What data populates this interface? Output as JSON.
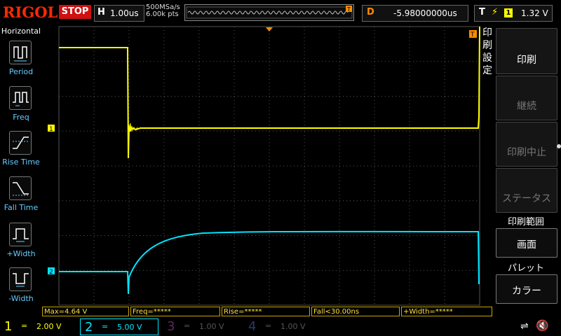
{
  "header": {
    "brand": "RIGOL",
    "run_state": "STOP",
    "timebase_key": "H",
    "timebase_value": "1.00us",
    "sample_rate": "500MSa/s",
    "memory_depth": "6.00k pts",
    "delay_key": "D",
    "delay_value": "-5.98000000us",
    "trigger_key": "T",
    "trigger_edge_icon": "rising-edge-icon",
    "trigger_channel": "1",
    "trigger_level": "1.32 V"
  },
  "left_menu": {
    "title": "Horizontal",
    "items": [
      {
        "label": "Period",
        "icon": "period-icon"
      },
      {
        "label": "Freq",
        "icon": "freq-icon"
      },
      {
        "label": "Rise Time",
        "icon": "rise-time-icon"
      },
      {
        "label": "Fall Time",
        "icon": "fall-time-icon"
      },
      {
        "label": "+Width",
        "icon": "positive-width-icon"
      },
      {
        "label": "-Width",
        "icon": "negative-width-icon"
      }
    ]
  },
  "right_menu": {
    "vertical_title": [
      "印",
      "刷",
      "設",
      "定"
    ],
    "print_button": "印刷",
    "continue_button": "継続",
    "stop_print_button": "印刷中止",
    "status_button": "ステータス",
    "range_header": "印刷範囲",
    "range_value": "画面",
    "palette_header": "パレット",
    "palette_value": "カラー"
  },
  "measurements": [
    "Max=4.64 V",
    "Freq=*****",
    "Rise=*****",
    "Fall<30.00ns",
    "+Width=*****"
  ],
  "channels": [
    {
      "number": "1",
      "coupling": "=",
      "scale": "2.00 V",
      "color": "#ffff00",
      "active": true
    },
    {
      "number": "2",
      "coupling": "=",
      "scale": "5.00 V",
      "color": "#00ffff",
      "active": true
    },
    {
      "number": "3",
      "coupling": "=",
      "scale": "1.00 V",
      "color": "#ff00ff",
      "active": false
    },
    {
      "number": "4",
      "coupling": "=",
      "scale": "1.00 V",
      "color": "#3080ff",
      "active": false
    }
  ],
  "markers": {
    "ch1": "1",
    "ch2": "2",
    "trigger": "T"
  },
  "colors": {
    "ch1": "#ffff00",
    "ch2": "#00e5ff",
    "trigger": "#ff8c00",
    "brand": "#ff2a00",
    "stop": "#d01010"
  },
  "status_icons": [
    "usb-icon",
    "speaker-mute-icon"
  ]
}
